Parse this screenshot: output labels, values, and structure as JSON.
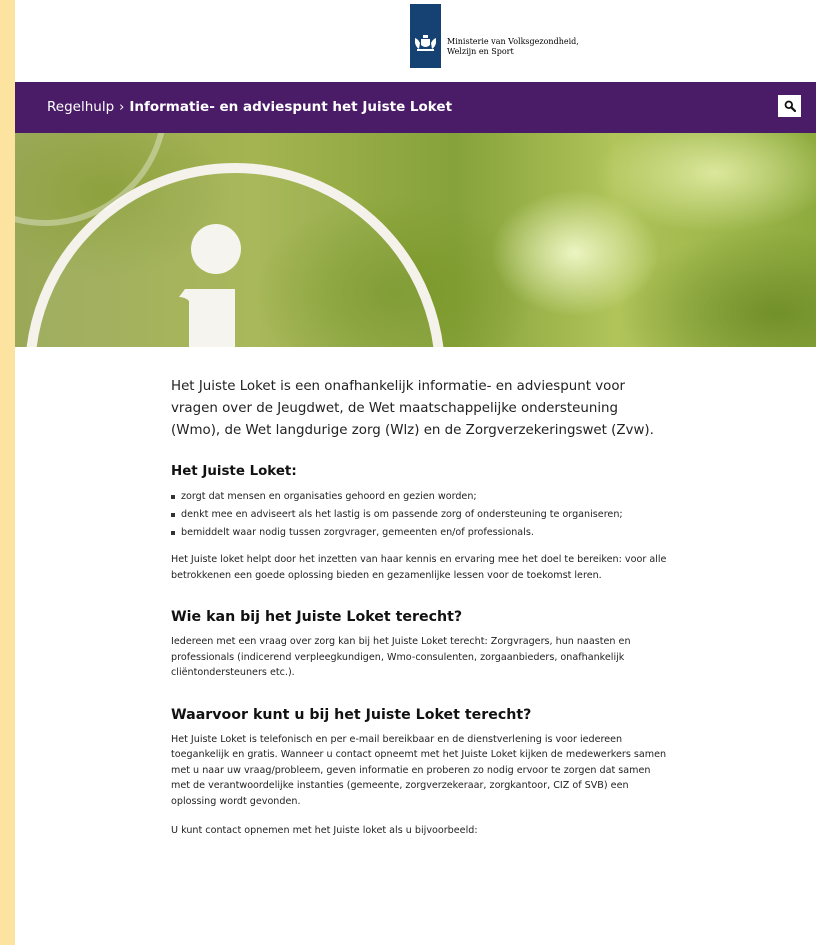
{
  "header": {
    "logo_line1": "Ministerie van Volksgezondheid,",
    "logo_line2": "Welzijn en Sport",
    "logo_icon": "rijksoverheid-emblem-icon"
  },
  "nav": {
    "breadcrumb_parent": "Regelhulp",
    "breadcrumb_separator": "›",
    "breadcrumb_current": "Informatie- en adviespunt het Juiste Loket",
    "search_icon": "search-icon"
  },
  "colors": {
    "nav_background": "#4a1c68",
    "page_background": "#fde3a0",
    "logo_background": "#154273"
  },
  "content": {
    "intro": "Het Juiste Loket is een onafhankelijk informatie- en adviespunt voor vragen over de Jeugdwet, de Wet maatschappelijke ondersteuning (Wmo), de Wet langdurige zorg (Wlz) en de Zorgverzekeringswet (Zvw).",
    "section1": {
      "heading": "Het Juiste Loket:",
      "items": [
        "zorgt dat mensen en organisaties gehoord en gezien worden;",
        "denkt mee en adviseert als het lastig is om passende zorg of ondersteuning te organiseren;",
        "bemiddelt waar nodig tussen zorgvrager, gemeenten en/of professionals."
      ],
      "paragraph": "Het Juiste loket helpt door het inzetten van haar kennis en ervaring mee het doel te bereiken: voor alle betrokkenen een goede oplossing bieden en gezamenlijke lessen voor de toekomst leren."
    },
    "section2": {
      "heading": "Wie kan bij het Juiste Loket terecht?",
      "paragraph": "Iedereen met een vraag over zorg kan bij het Juiste Loket terecht: Zorgvragers, hun naasten en professionals (indicerend verpleegkundigen, Wmo-consulenten, zorgaanbieders, onafhankelijk cliëntondersteuners etc.)."
    },
    "section3": {
      "heading": "Waarvoor kunt u bij het Juiste Loket terecht?",
      "paragraph": "Het Juiste Loket is telefonisch en per e-mail bereikbaar en de dienstverlening is voor iedereen toegankelijk en gratis. Wanneer u contact opneemt met het Juiste Loket kijken de medewerkers samen met u naar uw vraag/probleem, geven informatie en proberen zo nodig ervoor te zorgen dat samen met de verantwoordelijke instanties (gemeente, zorgverzekeraar, zorgkantoor, CIZ of SVB) een oplossing wordt gevonden.",
      "paragraph2": "U kunt contact opnemen met het Juiste loket als u bijvoorbeeld:"
    }
  }
}
